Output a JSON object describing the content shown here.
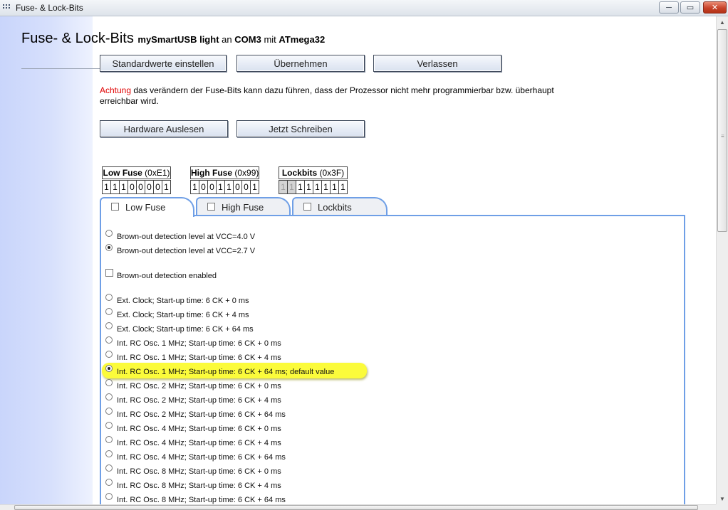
{
  "window": {
    "title": "Fuse- & Lock-Bits",
    "minimize_glyph": "─",
    "maximize_glyph": "▭",
    "close_glyph": "✕"
  },
  "header": {
    "title": "Fuse- & Lock-Bits",
    "device_programmer": "mySmartUSB light",
    "connector_word": "an",
    "port": "COM3",
    "with_word": "mit",
    "chip": "ATmega32"
  },
  "toolbar": {
    "defaults_label": "Standardwerte einstellen",
    "apply_label": "Übernehmen",
    "exit_label": "Verlassen"
  },
  "warning": {
    "keyword": "Achtung",
    "text": " das verändern der Fuse-Bits kann dazu führen, dass der Prozessor nicht mehr programmierbar bzw. überhaupt erreichbar wird.",
    "keyword_color": "#e00000"
  },
  "actions": {
    "read_label": "Hardware Auslesen",
    "write_label": "Jetzt Schreiben"
  },
  "fuses": [
    {
      "name": "Low Fuse",
      "hex": "(0xE1)",
      "bits": [
        "1",
        "1",
        "1",
        "0",
        "0",
        "0",
        "0",
        "1"
      ],
      "disabled": [
        false,
        false,
        false,
        false,
        false,
        false,
        false,
        false
      ]
    },
    {
      "name": "High Fuse",
      "hex": "(0x99)",
      "bits": [
        "1",
        "0",
        "0",
        "1",
        "1",
        "0",
        "0",
        "1"
      ],
      "disabled": [
        false,
        false,
        false,
        false,
        false,
        false,
        false,
        false
      ]
    },
    {
      "name": "Lockbits",
      "hex": "(0x3F)",
      "bits": [
        "1",
        "1",
        "1",
        "1",
        "1",
        "1",
        "1",
        "1"
      ],
      "disabled": [
        true,
        true,
        false,
        false,
        false,
        false,
        false,
        false
      ]
    }
  ],
  "tabs": [
    {
      "label": "Low Fuse",
      "active": true
    },
    {
      "label": "High Fuse",
      "active": false
    },
    {
      "label": "Lockbits",
      "active": false
    }
  ],
  "options": [
    {
      "kind": "radio",
      "label": "Brown-out detection level at VCC=4.0 V",
      "checked": false
    },
    {
      "kind": "radio",
      "label": "Brown-out detection level at VCC=2.7 V",
      "checked": true
    },
    {
      "kind": "checkbox",
      "label": "Brown-out detection enabled",
      "checked": false
    },
    {
      "kind": "radio",
      "label": "Ext. Clock; Start-up time: 6 CK + 0 ms",
      "checked": false
    },
    {
      "kind": "radio",
      "label": "Ext. Clock; Start-up time: 6 CK + 4 ms",
      "checked": false
    },
    {
      "kind": "radio",
      "label": "Ext. Clock; Start-up time: 6 CK + 64 ms",
      "checked": false
    },
    {
      "kind": "radio",
      "label": "Int. RC Osc. 1 MHz; Start-up time: 6 CK + 0 ms",
      "checked": false
    },
    {
      "kind": "radio",
      "label": "Int. RC Osc. 1 MHz; Start-up time: 6 CK + 4 ms",
      "checked": false
    },
    {
      "kind": "radio",
      "label": "Int. RC Osc. 1 MHz; Start-up time: 6 CK + 64 ms; default value",
      "checked": true,
      "highlighted": true
    },
    {
      "kind": "radio",
      "label": "Int. RC Osc. 2 MHz; Start-up time: 6 CK + 0 ms",
      "checked": false
    },
    {
      "kind": "radio",
      "label": "Int. RC Osc. 2 MHz; Start-up time: 6 CK + 4 ms",
      "checked": false
    },
    {
      "kind": "radio",
      "label": "Int. RC Osc. 2 MHz; Start-up time: 6 CK + 64 ms",
      "checked": false
    },
    {
      "kind": "radio",
      "label": "Int. RC Osc. 4 MHz; Start-up time: 6 CK + 0 ms",
      "checked": false
    },
    {
      "kind": "radio",
      "label": "Int. RC Osc. 4 MHz; Start-up time: 6 CK + 4 ms",
      "checked": false
    },
    {
      "kind": "radio",
      "label": "Int. RC Osc. 4 MHz; Start-up time: 6 CK + 64 ms",
      "checked": false
    },
    {
      "kind": "radio",
      "label": "Int. RC Osc. 8 MHz; Start-up time: 6 CK + 0 ms",
      "checked": false
    },
    {
      "kind": "radio",
      "label": "Int. RC Osc. 8 MHz; Start-up time: 6 CK + 4 ms",
      "checked": false
    },
    {
      "kind": "radio",
      "label": "Int. RC Osc. 8 MHz; Start-up time: 6 CK + 64 ms",
      "checked": false
    }
  ],
  "colors": {
    "tab_border": "#6f9fe6",
    "highlight": "#fbfb3b",
    "sidebar_gradient": "#c9d5fb"
  }
}
